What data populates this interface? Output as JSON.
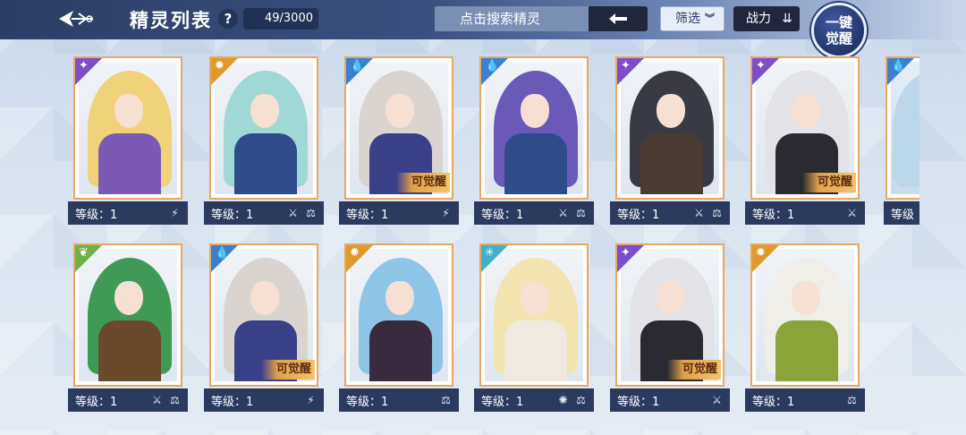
{
  "header": {
    "title": "精灵列表",
    "help": "?",
    "count": "49/3000",
    "search_placeholder": "点击搜索精灵",
    "filter_label": "筛选",
    "filter_chevron": "»",
    "power_label": "战力",
    "awaken_label_line1": "一键",
    "awaken_label_line2": "觉醒"
  },
  "icons": {
    "back": "back-arrow-icon",
    "search": "arrow-left-icon",
    "sort": "sort-icon"
  },
  "level_label": "等级：1",
  "awaken_tag": "可觉醒",
  "cards": [
    {
      "element": "dark",
      "elem_color": "#7b4fc9",
      "glyph": "✦",
      "awaken": false,
      "hair": "#f0d27a",
      "body": "#7b5ab5",
      "icons": [
        "⚡"
      ]
    },
    {
      "element": "fire",
      "elem_color": "#e09a2b",
      "glyph": "✹",
      "awaken": false,
      "hair": "#9fd8d4",
      "body": "#2f4c8a",
      "icons": [
        "⚔",
        "⚖"
      ]
    },
    {
      "element": "water",
      "elem_color": "#3b7fd1",
      "glyph": "💧",
      "awaken": true,
      "hair": "#d9d4cf",
      "body": "#3a3f8a",
      "icons": [
        "⚡"
      ]
    },
    {
      "element": "water",
      "elem_color": "#3b7fd1",
      "glyph": "💧",
      "awaken": false,
      "hair": "#6b59b8",
      "body": "#2f4c8a",
      "icons": [
        "⚔",
        "⚖"
      ]
    },
    {
      "element": "dark",
      "elem_color": "#7b4fc9",
      "glyph": "✦",
      "awaken": false,
      "hair": "#3a3a44",
      "body": "#4a3c34",
      "icons": [
        "⚔",
        "⚖"
      ]
    },
    {
      "element": "dark",
      "elem_color": "#7b4fc9",
      "glyph": "✦",
      "awaken": true,
      "hair": "#e3e2e6",
      "body": "#2b2a33",
      "icons": [
        "⚔"
      ]
    },
    {
      "element": "nature",
      "elem_color": "#6cb04a",
      "glyph": "❦",
      "awaken": false,
      "hair": "#3f9a55",
      "body": "#6a4a2a",
      "icons": [
        "⚔",
        "⚖"
      ]
    },
    {
      "element": "water",
      "elem_color": "#3b7fd1",
      "glyph": "💧",
      "awaken": true,
      "hair": "#d9d4cf",
      "body": "#3a3f8a",
      "icons": [
        "⚡"
      ]
    },
    {
      "element": "fire",
      "elem_color": "#e09a2b",
      "glyph": "✹",
      "awaken": false,
      "hair": "#8ec4e6",
      "body": "#3a2a3e",
      "icons": [
        "⚖"
      ]
    },
    {
      "element": "light",
      "elem_color": "#3fb2c9",
      "glyph": "✳",
      "awaken": false,
      "hair": "#f1e4b0",
      "body": "#efe9e0",
      "icons": [
        "✺",
        "⚖"
      ]
    },
    {
      "element": "dark",
      "elem_color": "#7b4fc9",
      "glyph": "✦",
      "awaken": true,
      "hair": "#e3e2e6",
      "body": "#2b2a33",
      "icons": [
        "⚔"
      ]
    },
    {
      "element": "fire",
      "elem_color": "#e09a2b",
      "glyph": "✹",
      "awaken": false,
      "hair": "#f0eee8",
      "body": "#8aa43a",
      "icons": [
        "⚖"
      ]
    }
  ],
  "partial_card": {
    "element": "water",
    "elem_color": "#3b7fd1",
    "glyph": "💧",
    "level_label": "等级"
  }
}
